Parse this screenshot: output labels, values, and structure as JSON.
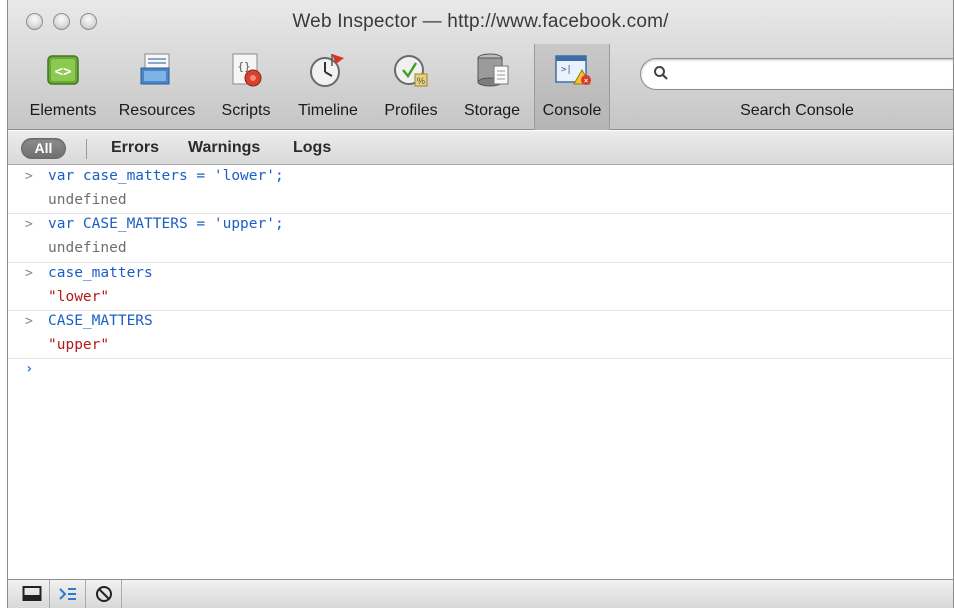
{
  "window": {
    "title": "Web Inspector — http://www.facebook.com/"
  },
  "toolbar": {
    "items": [
      {
        "label": "Elements",
        "icon": "elements-icon"
      },
      {
        "label": "Resources",
        "icon": "resources-icon"
      },
      {
        "label": "Scripts",
        "icon": "scripts-icon"
      },
      {
        "label": "Timeline",
        "icon": "timeline-icon"
      },
      {
        "label": "Profiles",
        "icon": "profiles-icon"
      },
      {
        "label": "Storage",
        "icon": "storage-icon"
      },
      {
        "label": "Console",
        "icon": "console-icon",
        "active": true
      }
    ],
    "search": {
      "label": "Search Console",
      "value": "",
      "placeholder": ""
    }
  },
  "filter": {
    "all_label": "All",
    "errors_label": "Errors",
    "warnings_label": "Warnings",
    "logs_label": "Logs"
  },
  "console": {
    "entries": [
      {
        "command": "var case_matters = 'lower';",
        "result": "undefined",
        "result_type": "undefined"
      },
      {
        "command": "var CASE_MATTERS = 'upper';",
        "result": "undefined",
        "result_type": "undefined"
      },
      {
        "command": "case_matters",
        "result": "\"lower\"",
        "result_type": "string"
      },
      {
        "command": "CASE_MATTERS",
        "result": "\"upper\"",
        "result_type": "string"
      }
    ],
    "prompt_symbol": "›",
    "colors": {
      "command": "#1b5ec6",
      "string": "#b11a1a",
      "undefined": "#6f6f6f"
    }
  },
  "statusbar": {
    "buttons": [
      "dock-icon",
      "console-toggle-icon",
      "clear-icon"
    ]
  }
}
